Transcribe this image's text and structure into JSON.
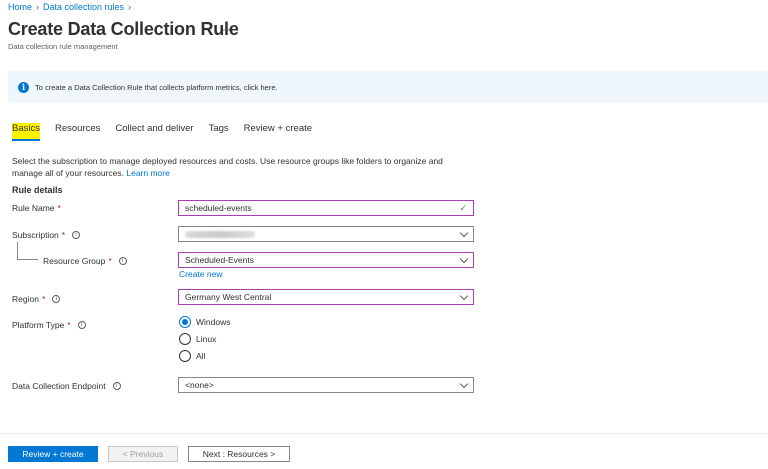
{
  "breadcrumb": {
    "home": "Home",
    "sep": ">",
    "current": "Data collection rules"
  },
  "header": {
    "title": "Create Data Collection Rule",
    "more": "···",
    "subtitle": "Data collection rule management"
  },
  "banner": {
    "icon": "info-icon",
    "text": "To create a Data Collection Rule that collects platform metrics, click here."
  },
  "tabs": [
    {
      "label": "Basics",
      "active": true
    },
    {
      "label": "Resources"
    },
    {
      "label": "Collect and deliver"
    },
    {
      "label": "Tags"
    },
    {
      "label": "Review + create"
    }
  ],
  "description": {
    "text": "Select the subscription to manage deployed resources and costs. Use resource groups like folders to organize and manage all of your resources.",
    "link": "Learn more"
  },
  "section": {
    "title": "Rule details"
  },
  "form": {
    "rule_name": {
      "label": "Rule Name",
      "required": "*",
      "value": "scheduled-events"
    },
    "subscription": {
      "label": "Subscription",
      "required": "*",
      "help": "i"
    },
    "resource_group": {
      "label": "Resource Group",
      "required": "*",
      "help": "i",
      "value": "Scheduled-Events",
      "create_new": "Create new"
    },
    "region": {
      "label": "Region",
      "required": "*",
      "help": "i",
      "value": "Germany West Central"
    },
    "platform_type": {
      "label": "Platform Type",
      "required": "*",
      "help": "i",
      "options": [
        "Windows",
        "Linux",
        "All"
      ],
      "selected": "Windows"
    },
    "endpoint": {
      "label": "Data Collection Endpoint",
      "help": "i",
      "value": "<none>"
    }
  },
  "footer": {
    "review_create": "Review + create",
    "previous": "< Previous",
    "next": "Next : Resources >"
  },
  "colors": {
    "accent": "#0078d4",
    "focus_border": "#a93fb3",
    "tab_highlight": "#fff100"
  }
}
